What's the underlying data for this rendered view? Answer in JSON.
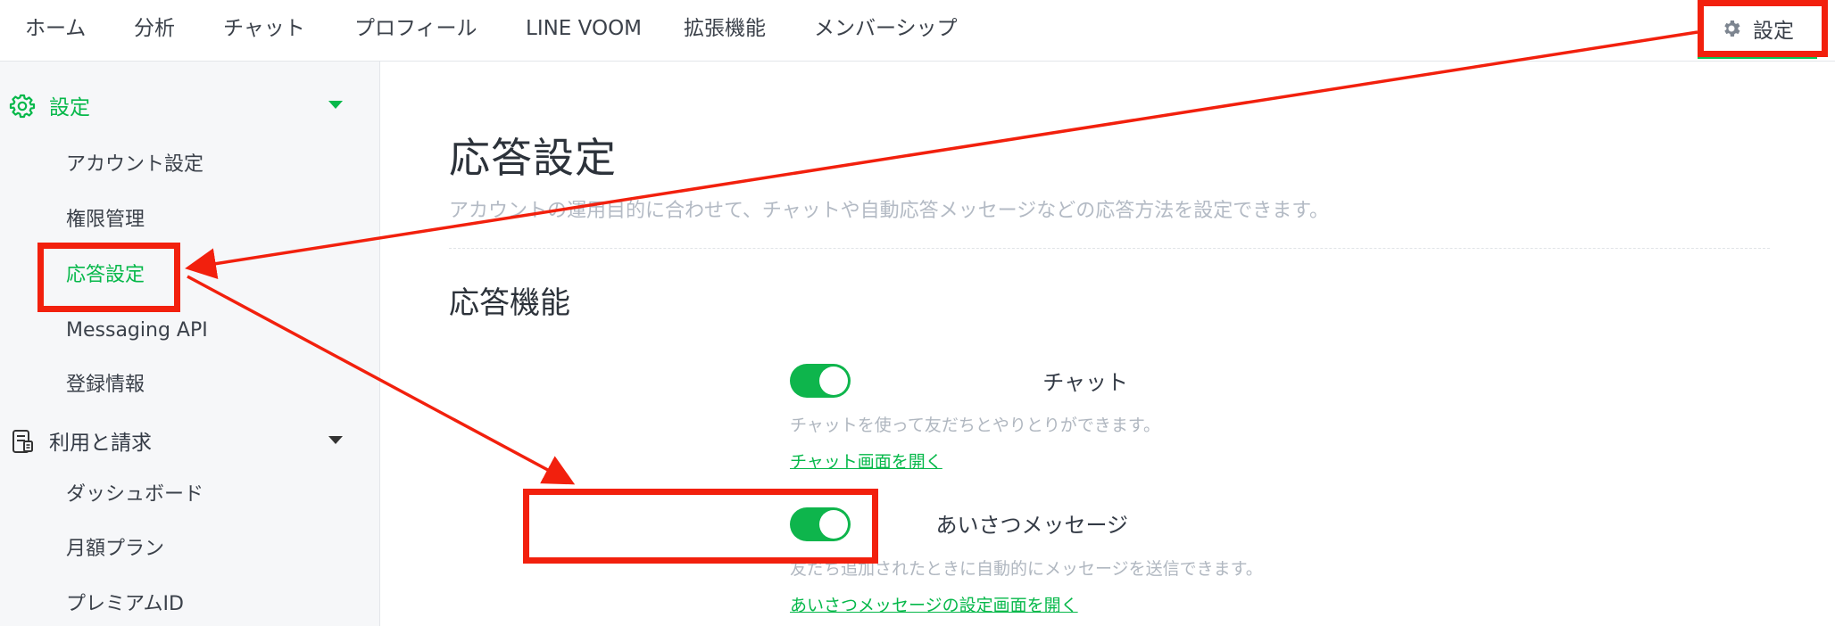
{
  "topnav": {
    "items": [
      {
        "label": "ホーム"
      },
      {
        "label": "分析"
      },
      {
        "label": "チャット"
      },
      {
        "label": "プロフィール"
      },
      {
        "label": "LINE VOOM"
      },
      {
        "label": "拡張機能"
      },
      {
        "label": "メンバーシップ"
      }
    ],
    "settings_label": "設定",
    "settings_icon": "gear-icon"
  },
  "sidebar": {
    "groups": [
      {
        "label": "設定",
        "icon": "gear-outline-icon",
        "expanded": true,
        "items": [
          {
            "label": "アカウント設定"
          },
          {
            "label": "権限管理"
          },
          {
            "label": "応答設定",
            "active": true
          },
          {
            "label": "Messaging API"
          },
          {
            "label": "登録情報"
          }
        ]
      },
      {
        "label": "利用と請求",
        "icon": "billing-document-icon",
        "expanded": true,
        "items": [
          {
            "label": "ダッシュボード"
          },
          {
            "label": "月額プラン"
          },
          {
            "label": "プレミアムID"
          }
        ]
      }
    ]
  },
  "main": {
    "title": "応答設定",
    "description": "アカウントの運用目的に合わせて、チャットや自動応答メッセージなどの応答方法を設定できます。",
    "section_title": "応答機能",
    "features": [
      {
        "label": "チャット",
        "enabled": true,
        "description": "チャットを使って友だちとやりとりができます。",
        "link": "チャット画面を開く"
      },
      {
        "label": "あいさつメッセージ",
        "enabled": true,
        "description": "友だち追加されたときに自動的にメッセージを送信できます。",
        "link": "あいさつメッセージの設定画面を開く"
      }
    ]
  },
  "colors": {
    "accent_green": "#06c755",
    "annotation_red": "#f2200d"
  }
}
